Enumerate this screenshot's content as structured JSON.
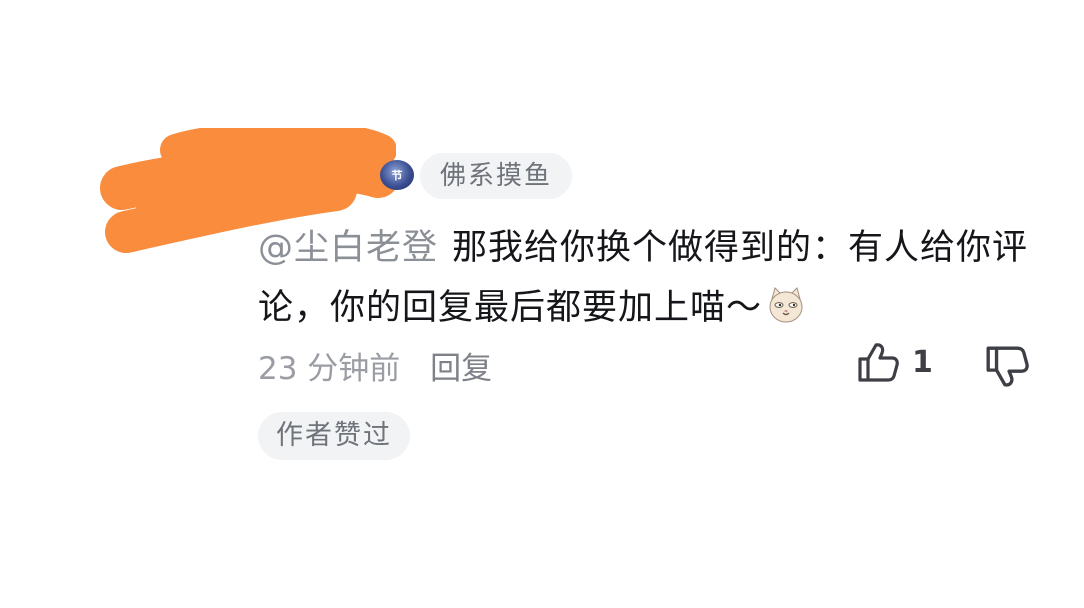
{
  "comment": {
    "user_tag": "佛系摸鱼",
    "level_badge_text": "节",
    "mention": "@尘白老登",
    "body_text": "那我给你换个做得到的：有人给你评论，你的回复最后都要加上喵～",
    "emoji_icon": "cat-face-emoji",
    "timestamp": "23 分钟前",
    "reply_label": "回复",
    "like_count": "1",
    "author_liked_label": "作者赞过"
  },
  "colors": {
    "redaction": "#f98c3d",
    "tag_background": "#f2f3f5",
    "muted_text": "#9a9da3",
    "body_text": "#15161a"
  }
}
